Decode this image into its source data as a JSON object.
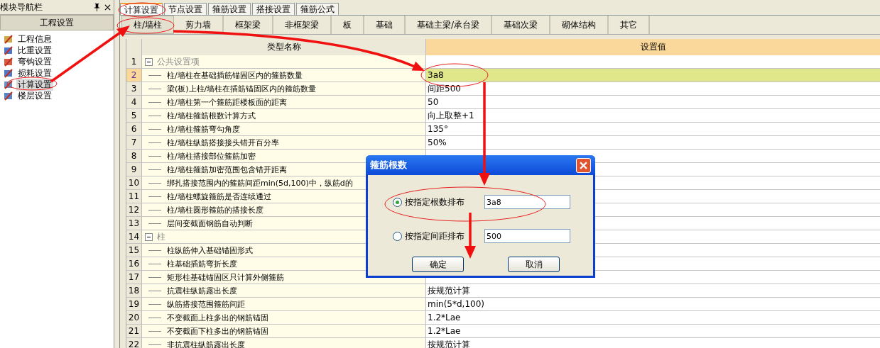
{
  "nav_panel": {
    "title": "模块导航栏",
    "section": "工程设置",
    "items": [
      {
        "label": "工程信息",
        "selected": false
      },
      {
        "label": "比重设置",
        "selected": false
      },
      {
        "label": "弯钩设置",
        "selected": false
      },
      {
        "label": "损耗设置",
        "selected": false
      },
      {
        "label": "计算设置",
        "selected": true
      },
      {
        "label": "楼层设置",
        "selected": false
      }
    ]
  },
  "tabs": [
    {
      "label": "计算设置",
      "selected": true
    },
    {
      "label": "节点设置",
      "selected": false
    },
    {
      "label": "箍筋设置",
      "selected": false
    },
    {
      "label": "搭接设置",
      "selected": false
    },
    {
      "label": "箍筋公式",
      "selected": false
    }
  ],
  "subtabs": [
    {
      "label": "柱/墙柱",
      "selected": true
    },
    {
      "label": "剪力墙",
      "selected": false
    },
    {
      "label": "框架梁",
      "selected": false
    },
    {
      "label": "非框架梁",
      "selected": false
    },
    {
      "label": "板",
      "selected": false
    },
    {
      "label": "基础",
      "selected": false
    },
    {
      "label": "基础主梁/承台梁",
      "selected": false
    },
    {
      "label": "基础次梁",
      "selected": false
    },
    {
      "label": "砌体结构",
      "selected": false
    },
    {
      "label": "其它",
      "selected": false
    }
  ],
  "table": {
    "columns": [
      "类型名称",
      "设置值"
    ],
    "rows": [
      {
        "number": "1",
        "kind": "group",
        "expanded": true,
        "name": "公共设置项",
        "selected": false
      },
      {
        "number": "2",
        "kind": "item",
        "name": "柱/墙柱在基础插筋锚固区内的箍筋数量",
        "value": "3a8",
        "selected": true
      },
      {
        "number": "3",
        "kind": "item",
        "name": "梁(板)上柱/墙柱在插筋锚固区内的箍筋数量",
        "value": "间距500",
        "selected": false
      },
      {
        "number": "4",
        "kind": "item",
        "name": "柱/墙柱第一个箍筋距楼板面的距离",
        "value": "50",
        "selected": false
      },
      {
        "number": "5",
        "kind": "item",
        "name": "柱/墙柱箍筋根数计算方式",
        "value": "向上取整+1",
        "selected": false
      },
      {
        "number": "6",
        "kind": "item",
        "name": "柱/墙柱箍筋弯勾角度",
        "value": "135°",
        "selected": false
      },
      {
        "number": "7",
        "kind": "item",
        "name": "柱/墙柱纵筋搭接接头错开百分率",
        "value": "50%",
        "selected": false
      },
      {
        "number": "8",
        "kind": "item",
        "name": "柱/墙柱搭接部位箍筋加密",
        "selected": false
      },
      {
        "number": "9",
        "kind": "item",
        "name": "柱/墙柱箍筋加密范围包含错开距离",
        "selected": false
      },
      {
        "number": "10",
        "kind": "item",
        "name": "绑扎搭接范围内的箍筋间距min(5d,100)中，纵筋d的",
        "selected": false
      },
      {
        "number": "11",
        "kind": "item",
        "name": "柱/墙柱螺旋箍筋是否连续通过",
        "selected": false
      },
      {
        "number": "12",
        "kind": "item",
        "name": "柱/墙柱圆形箍筋的搭接长度",
        "selected": false
      },
      {
        "number": "13",
        "kind": "item",
        "name": "层间变截面钢筋自动判断",
        "selected": false
      },
      {
        "number": "14",
        "kind": "group",
        "expanded": true,
        "name": "柱",
        "selected": false
      },
      {
        "number": "15",
        "kind": "item",
        "name": "柱纵筋伸入基础锚固形式",
        "selected": false
      },
      {
        "number": "16",
        "kind": "item",
        "name": "柱基础插筋弯折长度",
        "selected": false
      },
      {
        "number": "17",
        "kind": "item",
        "name": "矩形柱基础锚固区只计算外侧箍筋",
        "selected": false
      },
      {
        "number": "18",
        "kind": "item",
        "name": "抗震柱纵筋露出长度",
        "value": "按规范计算",
        "selected": false
      },
      {
        "number": "19",
        "kind": "item",
        "name": "纵筋搭接范围箍筋间距",
        "value": "min(5*d,100)",
        "selected": false
      },
      {
        "number": "20",
        "kind": "item",
        "name": "不变截面上柱多出的钢筋锚固",
        "value": "1.2*Lae",
        "selected": false
      },
      {
        "number": "21",
        "kind": "item",
        "name": "不变截面下柱多出的钢筋锚固",
        "value": "1.2*Lae",
        "selected": false
      },
      {
        "number": "22",
        "kind": "item",
        "name": "非抗震柱纵筋露出长度",
        "value": "按规范计算",
        "selected": false
      }
    ]
  },
  "dialog": {
    "title": "箍筋根数",
    "options": [
      {
        "label": "按指定根数排布",
        "value": "3a8",
        "selected": true
      },
      {
        "label": "按指定间距排布",
        "value": "500",
        "selected": false
      }
    ],
    "buttons": [
      "确定",
      "取消"
    ]
  }
}
